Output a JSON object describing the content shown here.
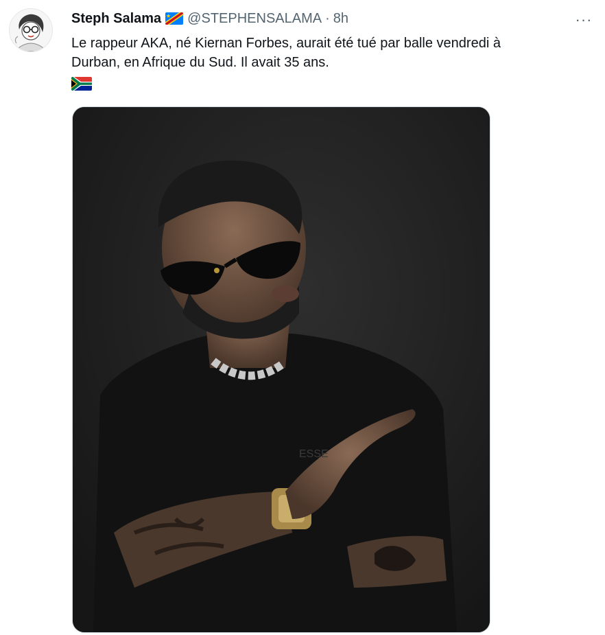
{
  "tweet": {
    "author_name": "Steph Salama",
    "author_flag": "flag-cd-icon",
    "handle": "@STEPHENSALAMA",
    "separator": "·",
    "time": "8h",
    "more_label": "···",
    "text_line1": "Le rappeur AKA, né Kiernan Forbes, aurait été tué par balle vendredi à",
    "text_line2": "Durban, en Afrique du Sud. Il avait 35 ans.",
    "text_flag": "flag-za-icon",
    "media_alt": "Photo of a man in black t-shirt and sunglasses",
    "shirt_print": "ESSE"
  },
  "colors": {
    "text_primary": "#0f1419",
    "text_secondary": "#536471",
    "media_border": "#cfd9de"
  }
}
